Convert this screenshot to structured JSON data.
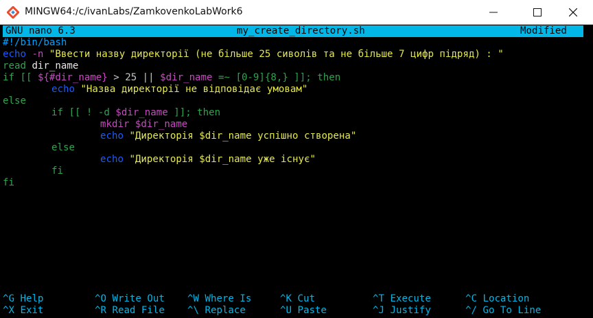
{
  "window": {
    "title": "MINGW64:/c/ivanLabs/ZamkovenkoLabWork6"
  },
  "nano": {
    "version": "GNU nano 6.3",
    "filename": "my_create_directory.sh",
    "status": "Modified"
  },
  "code": {
    "l1": "#!/bin/bash",
    "l2_echo": "echo",
    "l2_flag": " -n ",
    "l2_str": "\"Ввести назву директорії (не більше 25 сиволів та не більше 7 цифр підряд) : \"",
    "l3_read": "read",
    "l3_rest": " dir_name",
    "l4_if": "if",
    "l4_a": " [[ ",
    "l4_b": "${#dir_name}",
    "l4_c": " > 25 || ",
    "l4_d": "$dir_name",
    "l4_e": " =~ [0-9]{8,} ]]; then",
    "l5_echo": "echo",
    "l5_str": " \"Назва директорії не відповідає умовам\"",
    "l6": "else",
    "l7_if": "if",
    "l7_a": " [[ ! -d ",
    "l7_b": "$dir_name",
    "l7_c": " ]]; then",
    "l8_cmd": "mkdir",
    "l8_var": " $dir_name",
    "l9_echo": "echo",
    "l9_str": " \"Директорія $dir_name успішно створена\"",
    "l10": "else",
    "l11_echo": "echo",
    "l11_str": " \"Директорія $dir_name уже існує\"",
    "l12": "fi",
    "l13": "fi"
  },
  "shortcuts": [
    {
      "key": "^G",
      "label": " Help"
    },
    {
      "key": "^O",
      "label": " Write Out"
    },
    {
      "key": "^W",
      "label": " Where Is"
    },
    {
      "key": "^K",
      "label": " Cut"
    },
    {
      "key": "^T",
      "label": " Execute"
    },
    {
      "key": "^C",
      "label": " Location"
    },
    {
      "key": "^X",
      "label": " Exit"
    },
    {
      "key": "^R",
      "label": " Read File"
    },
    {
      "key": "^\\",
      "label": " Replace"
    },
    {
      "key": "^U",
      "label": " Paste"
    },
    {
      "key": "^J",
      "label": " Justify"
    },
    {
      "key": "^/",
      "label": " Go To Line"
    }
  ],
  "icons": {
    "app": "mingw-app-icon",
    "minimize": "minimize-icon",
    "maximize": "maximize-icon",
    "close": "close-icon"
  }
}
